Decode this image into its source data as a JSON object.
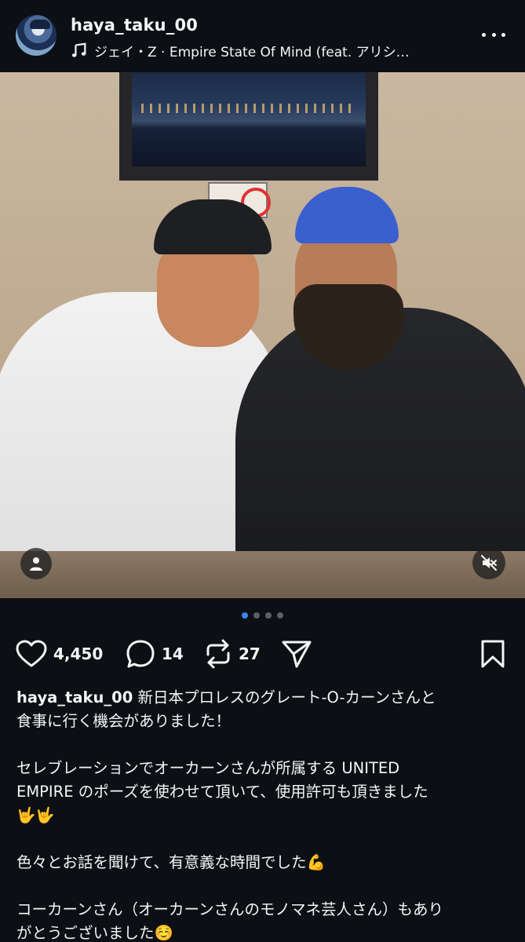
{
  "header": {
    "username": "haya_taku_00",
    "music_text": "ジェイ・Z · Empire State Of Mind (feat. アリシ…"
  },
  "carousel": {
    "total": 4,
    "active": 1
  },
  "actions": {
    "likes": "4,450",
    "comments": "14",
    "reposts": "27"
  },
  "caption": {
    "username": "haya_taku_00",
    "line1": " 新日本プロレスのグレート-O-カーンさんと",
    "line2": "食事に行く機会がありました！",
    "line3": "セレブレーションでオーカーンさんが所属する UNITED",
    "line4": "EMPIRE のポーズを使わせて頂いて、使用許可も頂きました",
    "line5": "🤟🤟",
    "line6": "色々とお話を聞けて、有意義な時間でした💪",
    "line7": "コーカーンさん（オーカーンさんのモノマネ芸人さん）もあり",
    "line8": "がとうございました☺️"
  },
  "colors": {
    "background": "#0c1014",
    "text": "#f5f5f5",
    "active_dot": "#3b82f6",
    "inactive_dot": "#5b5f66"
  },
  "icons": {
    "more": "more-horizontal-icon",
    "music": "music-note-icon",
    "like": "heart-outline-icon",
    "comment": "comment-bubble-icon",
    "repost": "repost-icon",
    "share": "send-paper-plane-icon",
    "save": "bookmark-icon",
    "user_tag": "person-icon",
    "mute": "speaker-muted-icon"
  }
}
